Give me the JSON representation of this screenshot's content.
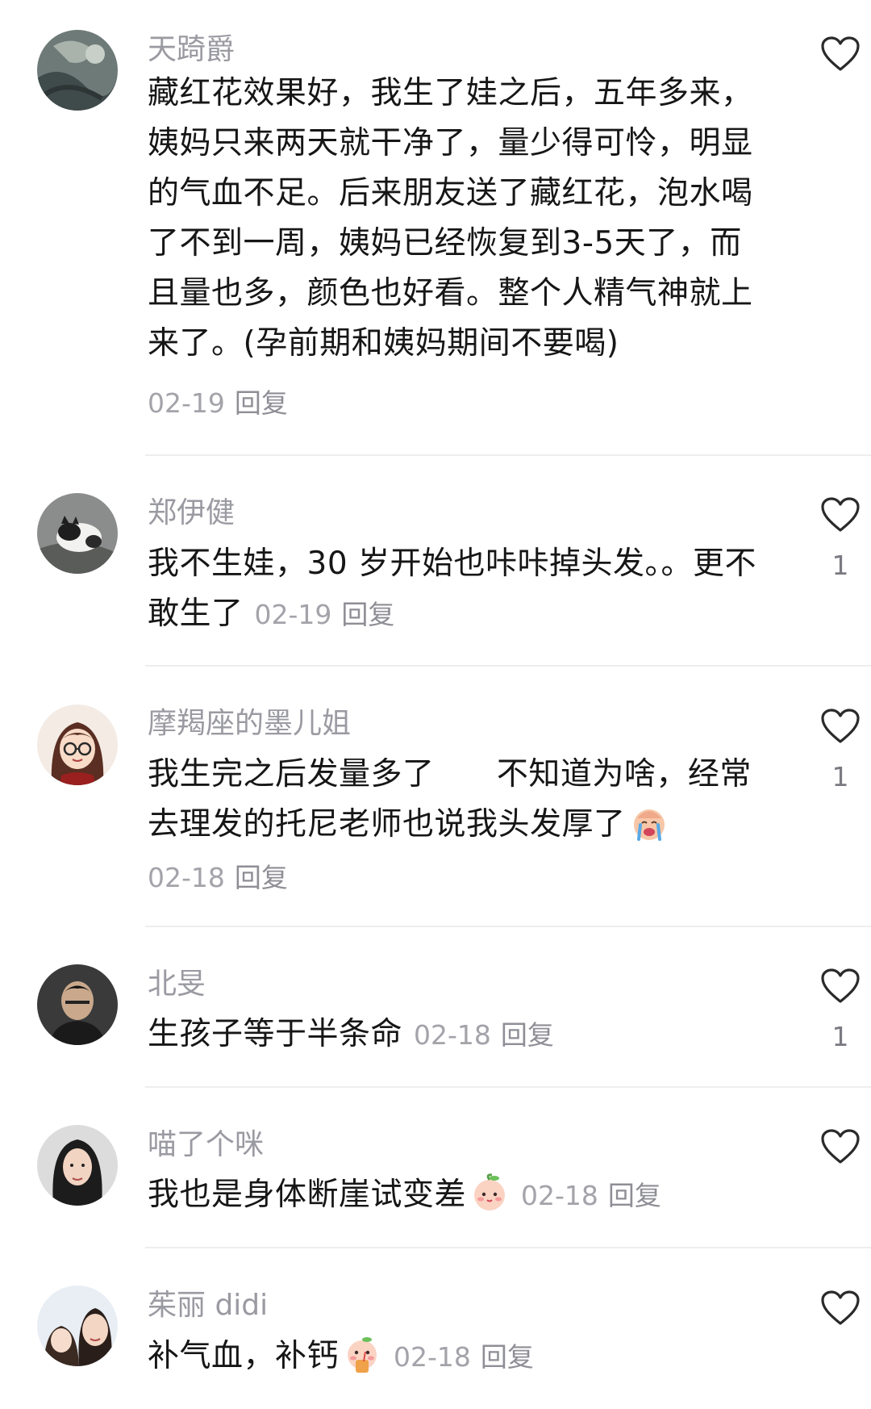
{
  "comments": [
    {
      "username": "天踦爵",
      "text_lines": [
        "藏红花效果好，我生了娃之后，五年多来，",
        "姨妈只来两天就干净了，量少得可怜，明显",
        "的气血不足。后来朋友送了藏红花，泡水喝",
        "了不到一周，姨妈已经恢复到3-5天了，而",
        "且量也多，颜色也好看。整个人精气神就上",
        "来了。(孕前期和姨妈期间不要喝)"
      ],
      "date": "02-19",
      "reply": "回复",
      "likes": "",
      "avatar_icon": "avatar-dark-painting"
    },
    {
      "username": "郑伊健",
      "text_lines": [
        "我不生娃，30 岁开始也咔咔掉头发。。更不",
        "敢生了"
      ],
      "date": "02-19",
      "reply": "回复",
      "likes": "1",
      "avatar_icon": "avatar-cat"
    },
    {
      "username": "摩羯座的墨儿姐",
      "text_lines": [
        "我生完之后发量多了      不知道为啥，经常",
        "去理发的托尼老师也说我头发厚了"
      ],
      "date": "02-18",
      "reply": "回复",
      "likes": "1",
      "avatar_icon": "avatar-cartoon-girl-glasses",
      "emoji_icon": "crying-emoji"
    },
    {
      "username": "北旻",
      "text_lines": [
        "生孩子等于半条命"
      ],
      "date": "02-18",
      "reply": "回复",
      "likes": "1",
      "avatar_icon": "avatar-man-dark"
    },
    {
      "username": "喵了个咪",
      "text_lines": [
        "我也是身体断崖试变差"
      ],
      "date": "02-18",
      "reply": "回复",
      "likes": "",
      "avatar_icon": "avatar-woman",
      "emoji_icon": "peach-emoji"
    },
    {
      "username": "茱丽 didi",
      "text_lines": [
        "补气血，补钙"
      ],
      "date": "02-18",
      "reply": "回复",
      "likes": "",
      "avatar_icon": "avatar-woman-child",
      "emoji_icon": "peach-drink-emoji"
    }
  ],
  "colors": {
    "username": "#9a9aa2",
    "text": "#161616",
    "meta": "#a3a3aa",
    "divider": "#eeeeee",
    "heart_stroke": "#2a2a2a"
  }
}
